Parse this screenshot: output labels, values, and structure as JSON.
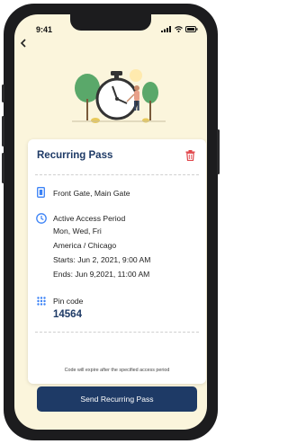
{
  "status_bar": {
    "time": "9:41"
  },
  "card": {
    "title": "Recurring Pass",
    "gates": "Front Gate, Main Gate",
    "period_label": "Active Access Period",
    "days": "Mon, Wed, Fri",
    "timezone": "America / Chicago",
    "starts": "Starts: Jun 2, 2021, 9:00 AM",
    "ends": "Ends: Jun 9,2021, 11:00 AM",
    "pin_label": "Pin code",
    "pin_value": "14564",
    "expire_note": "Code will expire after the specified access period"
  },
  "send_button_label": "Send Recurring Pass",
  "colors": {
    "accent": "#1e3a66",
    "icon_blue": "#3b82f6",
    "delete_red": "#e0454a",
    "screen_bg": "#fbf5dc"
  }
}
